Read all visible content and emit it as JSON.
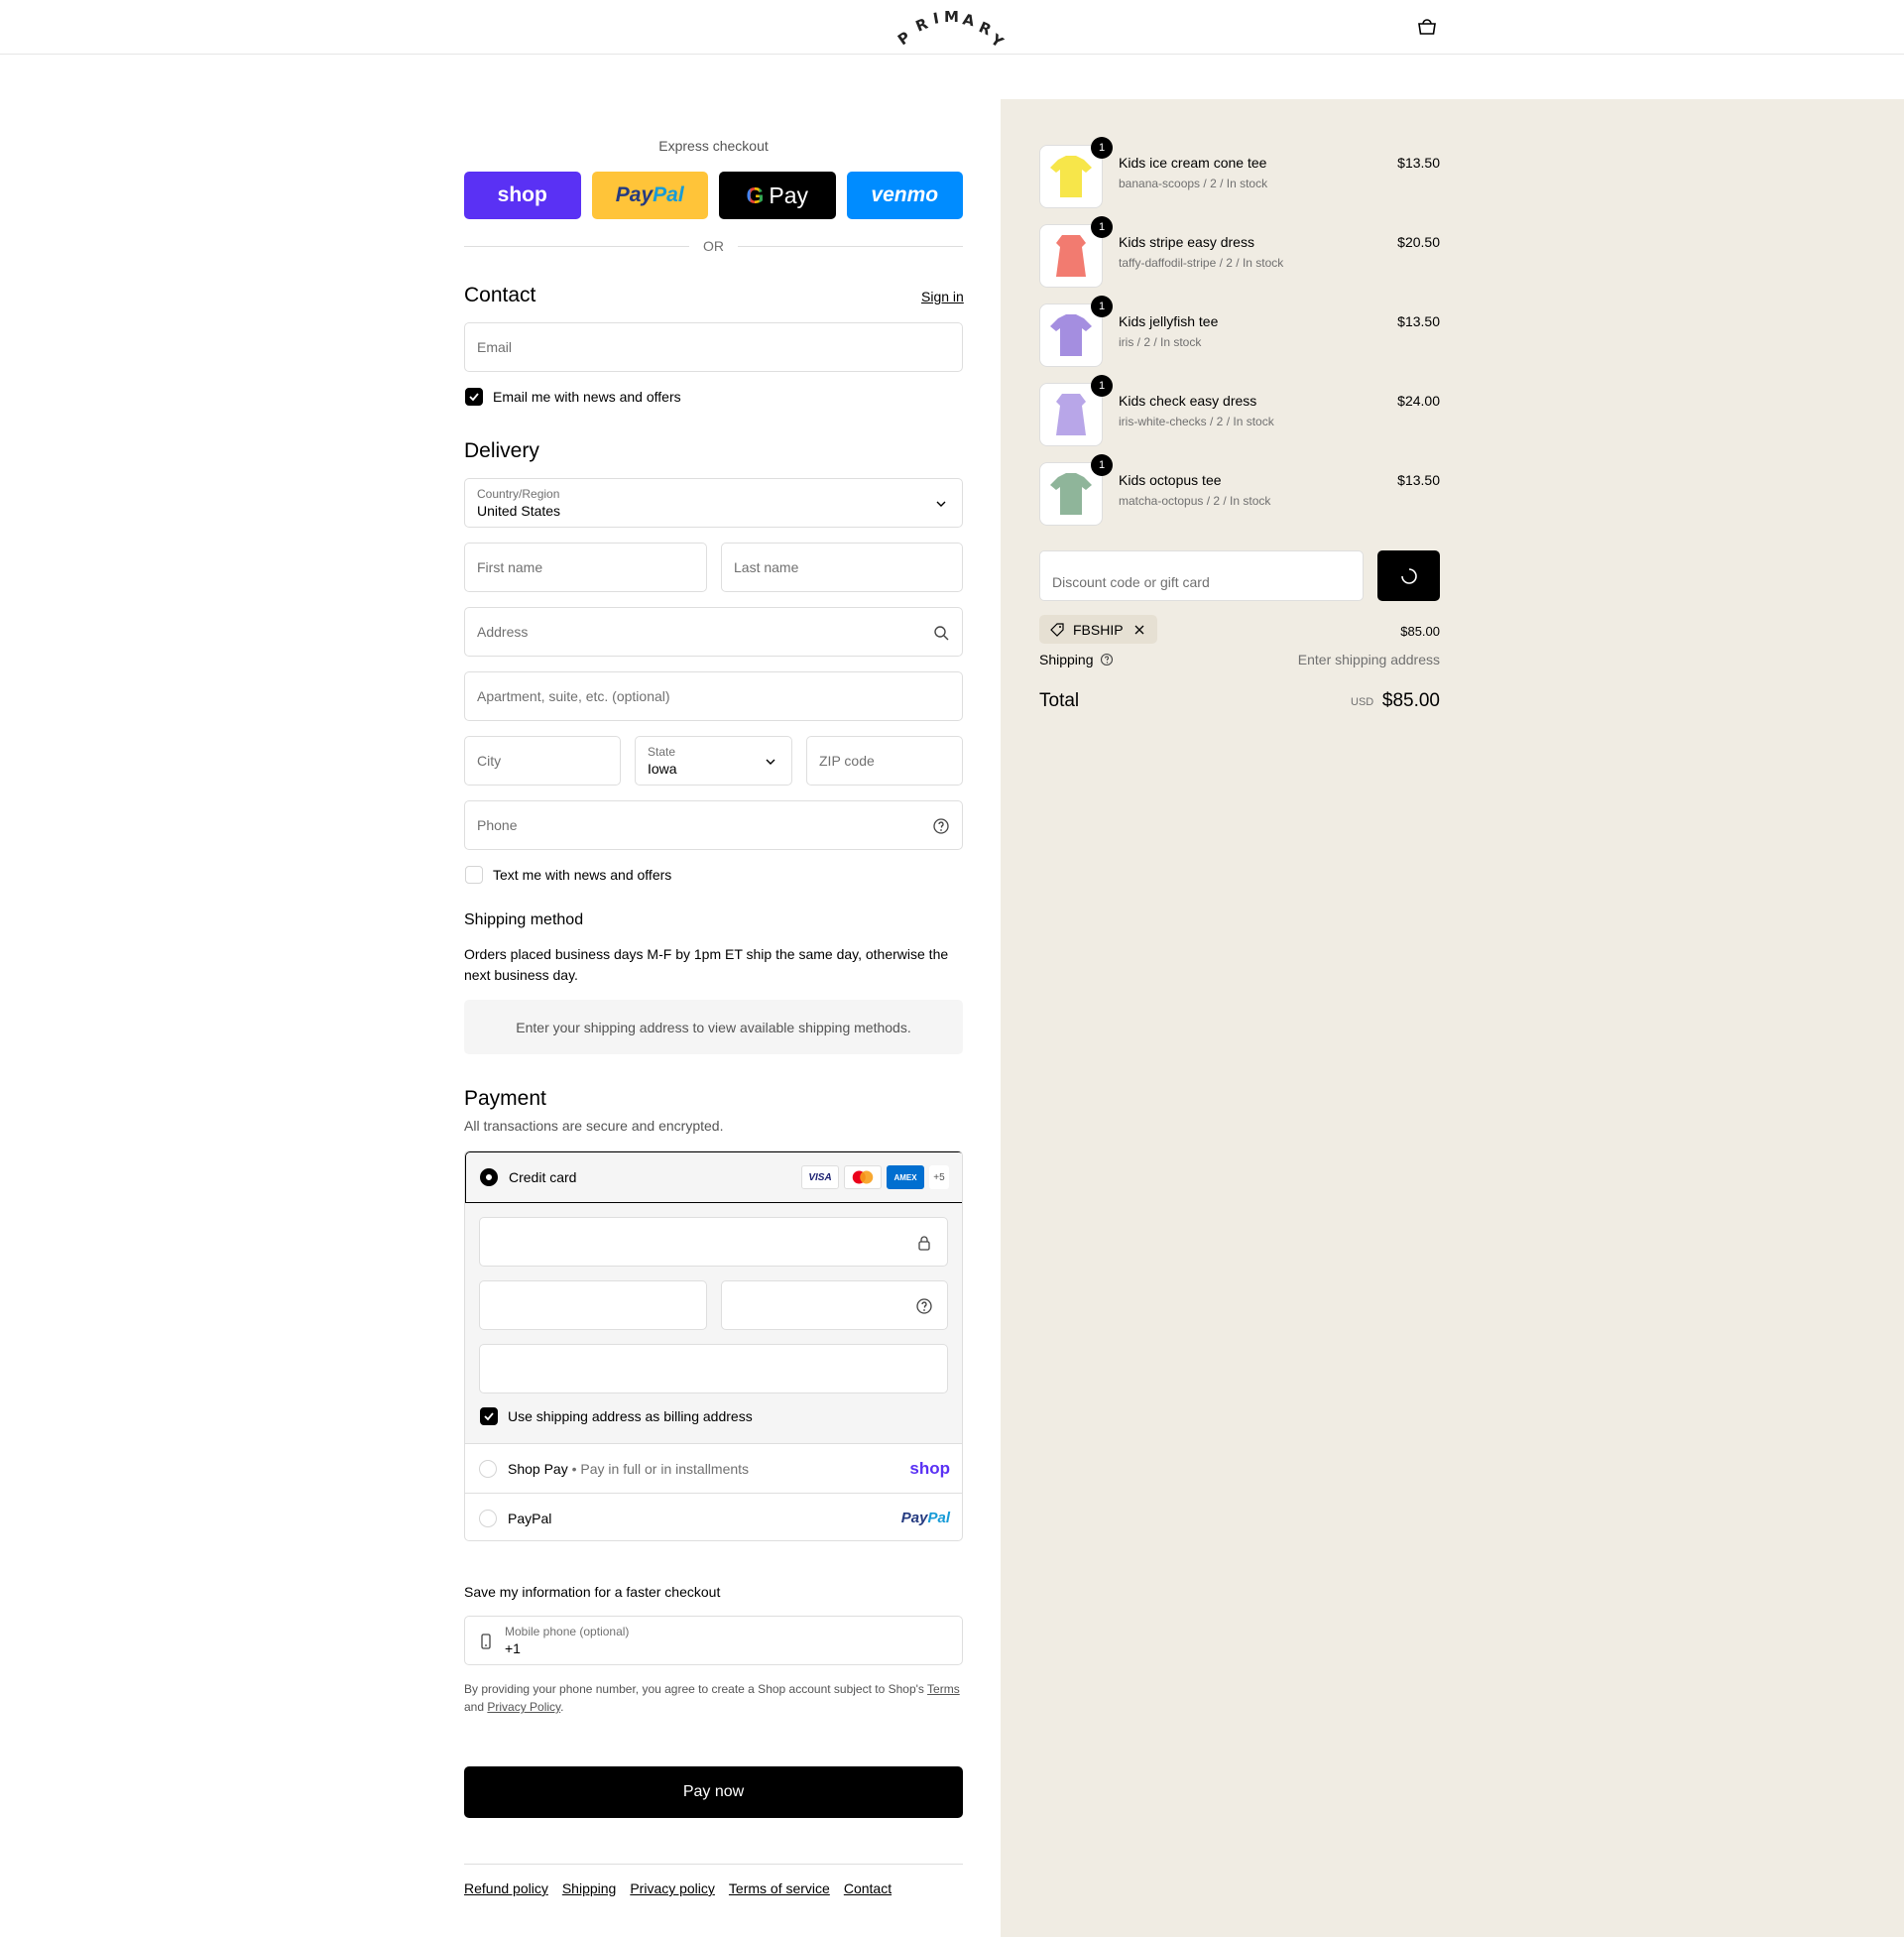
{
  "header": {
    "brand": "PRIMARY",
    "cart_icon": "bag-icon"
  },
  "express": {
    "title": "Express checkout",
    "shop_label": "shop",
    "paypal_label_1": "Pay",
    "paypal_label_2": "Pal",
    "gpay_g": "G",
    "gpay_label": "Pay",
    "venmo_label": "venmo",
    "or_label": "OR"
  },
  "contact": {
    "title": "Contact",
    "signin": "Sign in",
    "email_placeholder": "Email",
    "newsletter_label": "Email me with news and offers",
    "newsletter_checked": true
  },
  "delivery": {
    "title": "Delivery",
    "country_label": "Country/Region",
    "country_value": "United States",
    "first_name_placeholder": "First name",
    "last_name_placeholder": "Last name",
    "address_placeholder": "Address",
    "apartment_placeholder": "Apartment, suite, etc. (optional)",
    "city_placeholder": "City",
    "state_label": "State",
    "state_value": "Iowa",
    "zip_placeholder": "ZIP code",
    "phone_placeholder": "Phone",
    "sms_label": "Text me with news and offers",
    "sms_checked": false
  },
  "shipping_method": {
    "title": "Shipping method",
    "description": "Orders placed business days M-F by 1pm ET ship the same day, otherwise the next business day.",
    "placeholder": "Enter your shipping address to view available shipping methods."
  },
  "payment": {
    "title": "Payment",
    "subtitle": "All transactions are secure and encrypted.",
    "credit_card_label": "Credit card",
    "card_visa": "VISA",
    "card_amex": "AMEX",
    "card_more": "+5",
    "billing_same_label": "Use shipping address as billing address",
    "shop_pay_label": "Shop Pay",
    "shop_pay_note": "Pay in full or in installments",
    "shop_pay_logo": "shop",
    "paypal_label": "PayPal",
    "paypal_logo_1": "Pay",
    "paypal_logo_2": "Pal"
  },
  "save_info": {
    "title": "Save my information for a faster checkout",
    "mobile_label": "Mobile phone (optional)",
    "mobile_value": "+1",
    "legal_prefix": "By providing your phone number, you agree to create a Shop account subject to Shop's",
    "legal_terms": "Terms",
    "legal_and": "and",
    "legal_privacy": "Privacy Policy",
    "legal_suffix": "."
  },
  "pay_now_label": "Pay now",
  "footer_links": [
    "Refund policy",
    "Shipping",
    "Privacy policy",
    "Terms of service",
    "Contact"
  ],
  "order_summary": {
    "items": [
      {
        "name": "Kids ice cream cone tee",
        "variant": "banana-scoops / 2 / In stock",
        "price": "$13.50",
        "quantity": "1",
        "color": "#f7e64a"
      },
      {
        "name": "Kids stripe easy dress",
        "variant": "taffy-daffodil-stripe / 2 / In stock",
        "price": "$20.50",
        "quantity": "1",
        "color": "#f27b70"
      },
      {
        "name": "Kids jellyfish tee",
        "variant": "iris / 2 / In stock",
        "price": "$13.50",
        "quantity": "1",
        "color": "#a48ee0"
      },
      {
        "name": "Kids check easy dress",
        "variant": "iris-white-checks / 2 / In stock",
        "price": "$24.00",
        "quantity": "1",
        "color": "#b8a6e8"
      },
      {
        "name": "Kids octopus tee",
        "variant": "matcha-octopus / 2 / In stock",
        "price": "$13.50",
        "quantity": "1",
        "color": "#8fb59a"
      }
    ],
    "discount_placeholder": "Discount code or gift card",
    "discount_tag": "FBSHIP",
    "subtotal_value": "$85.00",
    "shipping_label": "Shipping",
    "shipping_value": "Enter shipping address",
    "total_label": "Total",
    "total_currency": "USD",
    "total_value": "$85.00"
  }
}
